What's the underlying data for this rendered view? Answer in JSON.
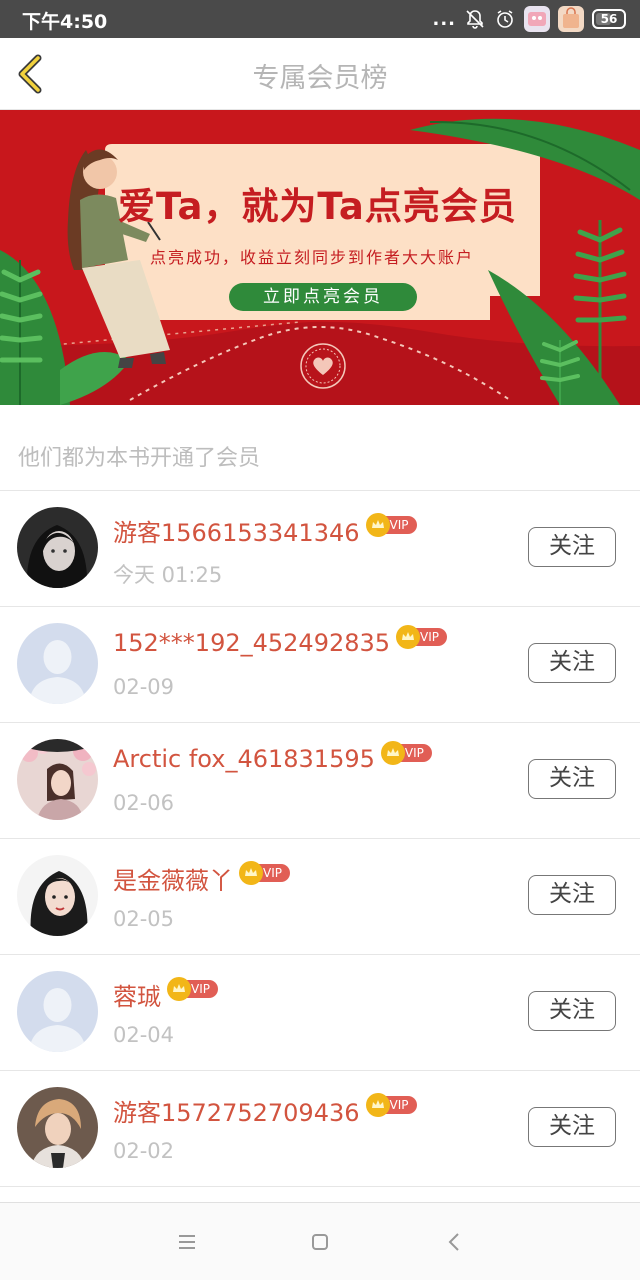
{
  "status_bar": {
    "time": "下午4:50",
    "dots": "...",
    "battery": "56"
  },
  "header": {
    "title": "专属会员榜",
    "back_icon": "chevron-left-icon"
  },
  "banner": {
    "headline": "爱Ta，就为Ta点亮会员",
    "subtitle": "点亮成功，收益立刻同步到作者大大账户",
    "button": "立即点亮会员",
    "colors": {
      "background": "#c8171c",
      "card": "#fde0c6",
      "button": "#2f8a3a"
    }
  },
  "section_title": "他们都为本书开通了会员",
  "members": [
    {
      "name": "游客1566153341346",
      "badge": "VIP",
      "date": "今天 01:25",
      "follow": "关注",
      "avatar": "photo-girl-dark-hair"
    },
    {
      "name": "152***192_452492835",
      "badge": "VIP",
      "date": "02-09",
      "follow": "关注",
      "avatar": "default-avatar"
    },
    {
      "name": "Arctic fox_461831595",
      "badge": "VIP",
      "date": "02-06",
      "follow": "关注",
      "avatar": "photo-blossom-girl"
    },
    {
      "name": "是金薇薇丫",
      "badge": "VIP",
      "date": "02-05",
      "follow": "关注",
      "avatar": "photo-woman-portrait"
    },
    {
      "name": "蓉珹",
      "badge": "VIP",
      "date": "02-04",
      "follow": "关注",
      "avatar": "default-avatar"
    },
    {
      "name": "游客1572752709436",
      "badge": "VIP",
      "date": "02-02",
      "follow": "关注",
      "avatar": "photo-young-man"
    }
  ],
  "theme": {
    "name_color": "#d2543f",
    "vip_color": "#e15e55",
    "crown_color": "#f2b618"
  }
}
